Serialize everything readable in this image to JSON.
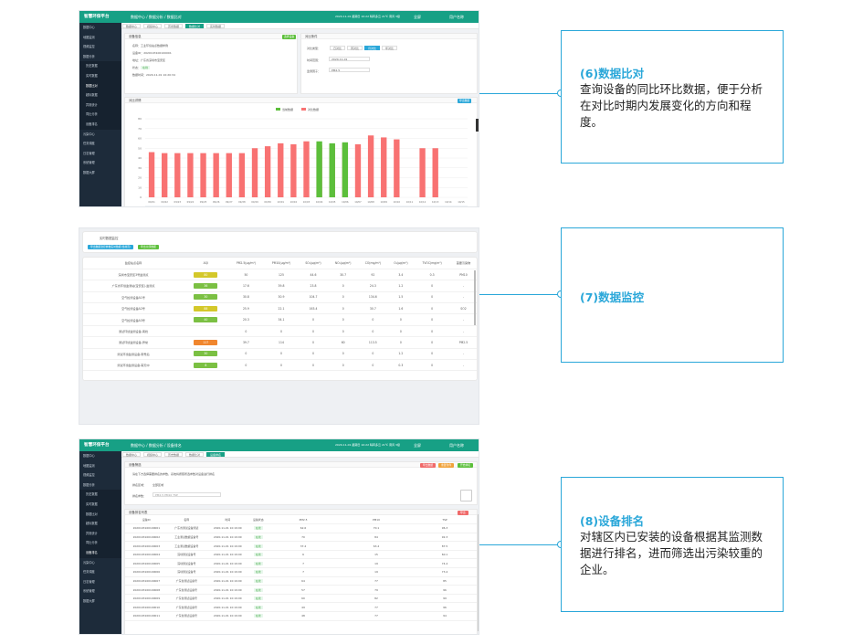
{
  "app": {
    "brand": "智慧环保平台",
    "user": "用户名称",
    "fullscreen_label": "全屏",
    "datetime": "2020-11-01 星期日 10:22",
    "weather": "晴转多云 21℃ 南风 3级"
  },
  "sidebar": {
    "items": [
      "数据中心",
      "地图监测",
      "视频监控",
      "数据分析",
      "历史数据",
      "实时数据",
      "数据比对",
      "超标数据",
      "异常统计",
      "同比分析",
      "设备排名",
      "污染中心",
      "任务调度",
      "日志管理",
      "系统管理",
      "数据大屏"
    ]
  },
  "panel1": {
    "breadcrumb": "数据中心 / 数据分析 / 数据比对",
    "tabs": [
      "数据中心",
      "视频中心",
      "历史数据",
      "数据比对",
      "实时数据"
    ],
    "info_card": {
      "title": "设备信息",
      "btn": "选择设备",
      "rows": [
        {
          "k": "名称：",
          "v": "工业环境站点数据样例"
        },
        {
          "k": "设备ID：",
          "v": "2020103100100001"
        },
        {
          "k": "地址：",
          "v": "广东省深圳市宝安区"
        },
        {
          "k": "状态：",
          "v": "在线"
        },
        {
          "k": "数据时间：",
          "v": "2020-11-01 10:20:34"
        }
      ]
    },
    "cond_card": {
      "title": "对比条件",
      "compare_label": "对比类型：",
      "compare_options": [
        "日对比",
        "周对比",
        "月对比",
        "年对比"
      ],
      "selected_option": "月对比",
      "date_label": "时间范围：",
      "date_value": "2020-11-01",
      "factor_label": "监测因子：",
      "factor_value": "PM2.5"
    },
    "chart_card": {
      "title": "对比详情",
      "btn": "导出数据"
    }
  },
  "panel2": {
    "title": "实时数据监控",
    "btn1": "导出数据监控参数实时数据(当前页)",
    "btn2": "导出全部数据",
    "columns": [
      "监控站点名称",
      "AQI",
      "PM2.5(μg/m³)",
      "PM10(μg/m³)",
      "SO₂(μg/m³)",
      "NO₂(μg/m³)",
      "CO(mg/m³)",
      "O₃(μg/m³)",
      "TVOC(mg/m³)",
      "首要污染物"
    ],
    "rows": [
      {
        "name": "深圳市宝安区3号监测点",
        "aqi": "80",
        "aqi_color": "#d4c82a",
        "v": [
          "50",
          "125",
          "44.6",
          "30.7",
          "92",
          "3.4",
          "0.3",
          "PM10"
        ]
      },
      {
        "name": "广东省环境监测站(宝安区)-监测点",
        "aqi": "36",
        "aqi_color": "#7bc043",
        "v": [
          "17.6",
          "39.8",
          "23.8",
          "0",
          "24.3",
          "1.2",
          "0",
          "-"
        ]
      },
      {
        "name": "空气检测设备A1号",
        "aqi": "30",
        "aqi_color": "#7bc043",
        "v": [
          "30.8",
          "30.9",
          "104.7",
          "0",
          "134.6",
          "1.5",
          "0",
          "-"
        ]
      },
      {
        "name": "空气检测设备A2号",
        "aqi": "88",
        "aqi_color": "#d4c82a",
        "v": [
          "25.9",
          "22.1",
          "163.4",
          "0",
          "30.7",
          "1.6",
          "0",
          "SO2"
        ]
      },
      {
        "name": "空气检测设备A3号",
        "aqi": "40",
        "aqi_color": "#7bc043",
        "v": [
          "20.3",
          "34.1",
          "0",
          "0",
          "0",
          "0",
          "0",
          "-"
        ]
      },
      {
        "name": "测试环境监测设备-离线",
        "aqi": "",
        "aqi_color": "",
        "v": [
          "0",
          "0",
          "0",
          "0",
          "0",
          "0",
          "0",
          "-"
        ]
      },
      {
        "name": "测试环境监测设备-异常",
        "aqi": "117",
        "aqi_color": "#f0862e",
        "v": [
          "39.7",
          "114",
          "0",
          "60",
          "113.5",
          "0",
          "0",
          "PM2.5"
        ]
      },
      {
        "name": "测试环境监测设备-雨雪后",
        "aqi": "30",
        "aqi_color": "#7bc043",
        "v": [
          "0",
          "0",
          "0",
          "0",
          "0",
          "1.2",
          "0",
          "-"
        ]
      },
      {
        "name": "测试环境监测设备-雾天中",
        "aqi": "8",
        "aqi_color": "#7bc043",
        "v": [
          "0",
          "0",
          "0",
          "0",
          "0",
          "0.3",
          "0",
          "-"
        ]
      }
    ]
  },
  "panel3": {
    "breadcrumb": "数据中心 / 数据分析 / 设备排名",
    "tabs": [
      "数据中心",
      "视频中心",
      "历史数据",
      "数据比对",
      "设备排名"
    ],
    "filter": {
      "title": "设备筛选",
      "hint": "请在下方选择需要排名的参数，系统将按照所选参数对设备进行排名",
      "area_label": "排名区域：",
      "area_value": "全部区域",
      "param_label": "排名参数：",
      "param_value": "PM2.5  PM10  TSP",
      "buttons": [
        "导出数据",
        "重置条件",
        "开始排名"
      ]
    },
    "ranking": {
      "title": "设备排名列表",
      "export_btn": "导出",
      "columns": [
        "设备ID",
        "名称",
        "时间",
        "设备状态",
        "PM2.5",
        "PM10",
        "TSP"
      ],
      "rows": [
        [
          "2020103100100001",
          "广东省测试设备测试",
          "2020-11-01 10:19:00",
          "在线",
          "62.6",
          "70.1",
          "96.3"
        ],
        [
          "2020103100100002",
          "工业测试数据设备号",
          "2020-11-01 10:19:00",
          "在线",
          "70",
          "84",
          "92.3"
        ],
        [
          "2020103100100003",
          "工业测试数据设备号",
          "2020-11-01 10:19:00",
          "在线",
          "37.4",
          "63.4",
          "87.5"
        ],
        [
          "2020103100100004",
          "深圳测试设备号",
          "2020-11-01 10:19:00",
          "在线",
          "6",
          "15",
          "60.1"
        ],
        [
          "2020103100100005",
          "深圳测试设备号",
          "2020-11-01 10:19:00",
          "在线",
          "7",
          "19",
          "74.4"
        ],
        [
          "2020103100100006",
          "深圳测试设备号",
          "2020-11-01 10:19:00",
          "在线",
          "7",
          "19",
          "73.4"
        ],
        [
          "2020103100100007",
          "广东省测试设备号",
          "2020-11-01 10:19:00",
          "在线",
          "64",
          "77",
          "85"
        ],
        [
          "2020103100100008",
          "广东省测试设备号",
          "2020-11-01 10:19:00",
          "在线",
          "57",
          "79",
          "96"
        ],
        [
          "2020103100100009",
          "广东省测试设备号",
          "2020-11-01 10:19:00",
          "在线",
          "60",
          "82",
          "99"
        ],
        [
          "2020103100100010",
          "广东省测试设备号",
          "2020-11-01 10:19:00",
          "在线",
          "49",
          "77",
          "96"
        ],
        [
          "2020103100100011",
          "广东省测试设备号",
          "2020-11-01 10:19:00",
          "在线",
          "48",
          "77",
          "94"
        ]
      ]
    }
  },
  "callouts": [
    {
      "title": "(6)数据比对",
      "desc": "查询设备的同比环比数据，便于分析在对比时期内发展变化的方向和程度。"
    },
    {
      "title": "(7)数据监控",
      "desc": ""
    },
    {
      "title": "(8)设备排名",
      "desc": "对辖区内已安装的设备根据其监测数据进行排名，进而筛选出污染较重的企业。"
    }
  ],
  "colors": {
    "brand": "#17a085",
    "sidebar": "#1d2b3a",
    "accent": "#2aa7d9",
    "bar_red": "#f87272",
    "bar_green": "#5cbf3b"
  },
  "chart_data": {
    "type": "bar",
    "legend": [
      "当前数据",
      "对比数据"
    ],
    "yticks": [
      "0",
      "10",
      "20",
      "30",
      "40",
      "50",
      "60",
      "70",
      "80"
    ],
    "ylim": [
      0,
      80
    ],
    "categories": [
      "09/21",
      "09/22",
      "09/23",
      "09/24",
      "09/25",
      "09/26",
      "09/27",
      "09/28",
      "09/29",
      "09/30",
      "10/01",
      "10/02",
      "10/03",
      "10/04",
      "10/05",
      "10/06",
      "10/07",
      "10/08",
      "10/09",
      "10/10",
      "10/11",
      "10/12",
      "10/13",
      "10/14",
      "10/15"
    ],
    "series": [
      {
        "name": "对比数据",
        "color": "#f87272",
        "values": [
          46,
          45,
          45,
          45,
          45,
          45,
          45,
          45,
          50,
          52,
          55,
          54,
          57,
          53,
          54,
          55,
          54,
          63,
          61,
          59,
          0,
          50,
          50,
          0,
          0
        ]
      },
      {
        "name": "当前数据",
        "color": "#5cbf3b",
        "values": [
          0,
          0,
          0,
          0,
          0,
          0,
          0,
          0,
          0,
          0,
          0,
          0,
          0,
          57,
          55,
          56,
          0,
          0,
          0,
          0,
          0,
          0,
          0,
          0,
          0
        ]
      }
    ]
  }
}
